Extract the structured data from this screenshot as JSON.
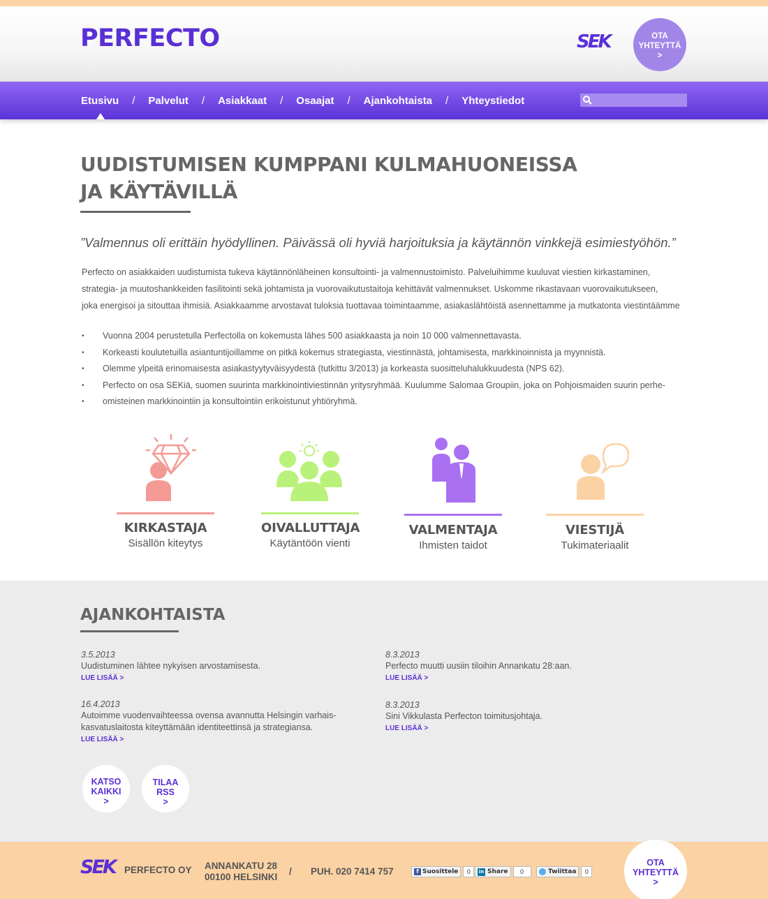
{
  "header": {
    "logo": "PERFECTO",
    "sek_logo": "SEK",
    "contact_button": {
      "line1": "OTA",
      "line2": "YHTEYTTÄ",
      "line3": ">"
    }
  },
  "nav": {
    "items": [
      "Etusivu",
      "Palvelut",
      "Asiakkaat",
      "Osaajat",
      "Ajankohtaista",
      "Yhteystiedot"
    ],
    "separator": "/",
    "active": "Etusivu",
    "search_value": ""
  },
  "main": {
    "title_line1": "UUDISTUMISEN KUMPPANI KULMAHUONEISSA",
    "title_line2": "JA KÄYTÄVILLÄ",
    "quote": "”Valmennus oli erittäin hyödyllinen. Päivässä oli hyviä harjoituksia ja käytännön vinkkejä esimiestyöhön.”",
    "intro_lines": [
      "Perfecto on asiakkaiden uudistumista tukeva käytännönläheinen konsultointi- ja valmennustoimisto. Palveluihimme kuuluvat viestien kirkastaminen,",
      "strategia- ja muutoshankkeiden fasilitointi sekä johtamista ja vuorovaikutustaitoja kehittävät valmennukset. Uskomme rikastavaan vuorovaikutukseen,",
      "joka energisoi ja sitouttaa ihmisiä. Asiakkaamme arvostavat tuloksia tuottavaa toimintaamme, asiakaslähtöistä asennettamme ja mutkatonta viestintäämme"
    ],
    "bullets": [
      "Vuonna 2004 perustetulla Perfectolla on kokemusta lähes 500 asiakkaasta ja noin 10 000 valmennettavasta.",
      "Korkeasti koulutetuilla asiantuntijoillamme on pitkä kokemus strategiasta, viestinnästä, johtamisesta, markkinoinnista ja myynnistä.",
      "Olemme ylpeitä erinomaisesta asiakastyytyväisyydestä (tutkittu 3/2013) ja korkeasta suositteluhalukkuudesta (NPS 62).",
      "Perfecto on osa SEKiä, suomen suurinta markkinointiviestinnän yritysryhmää. Kuulumme Salomaa Groupiin, joka on Pohjoismaiden suurin perhe-",
      "omisteinen markkinointiin ja konsultointiin erikoistunut yhtiöryhmä."
    ]
  },
  "roles": [
    {
      "title": "KIRKASTAJA",
      "subtitle": "Sisällön kiteytys",
      "icon": "diamond-person-icon",
      "color": "#f49a95"
    },
    {
      "title": "OIVALLUTTAJA",
      "subtitle": "Käytäntöön vienti",
      "icon": "lightbulb-group-icon",
      "color": "#b9f27a"
    },
    {
      "title": "VALMENTAJA",
      "subtitle": "Ihmisten taidot",
      "icon": "coach-people-icon",
      "color": "#a970f2"
    },
    {
      "title": "VIESTIJÄ",
      "subtitle": "Tukimateriaalit",
      "icon": "speech-person-icon",
      "color": "#fbd2a4"
    }
  ],
  "news": {
    "title": "AJANKOHTAISTA",
    "items": [
      {
        "date": "3.5.2013",
        "text_lines": [
          "Uudistuminen lähtee nykyisen arvostamisesta."
        ],
        "link": "LUE LISÄÄ >"
      },
      {
        "date": "16.4.2013",
        "text_lines": [
          "Autoimme vuodenvaihteessa ovensa avannutta Helsingin varhais-",
          "kasvatuslaitosta kiteyttämään identiteettinsä ja strategiansa."
        ],
        "link": "LUE LISÄÄ >"
      },
      {
        "date": "8.3.2013",
        "text_lines": [
          "Perfecto muutti uusiin tiloihin Annankatu 28:aan."
        ],
        "link": "LUE LISÄÄ >"
      },
      {
        "date": "8.3.2013",
        "text_lines": [
          "Sini Vikkulasta Perfecton toimitusjohtaja."
        ],
        "link": "LUE LISÄÄ >"
      }
    ],
    "view_all": {
      "line1": "KATSO",
      "line2": "KAIKKI",
      "line3": ">"
    },
    "rss": {
      "line1": "TILAA",
      "line2": "RSS",
      "line3": ">"
    }
  },
  "footer": {
    "sek_logo": "SEK",
    "company": "PERFECTO OY",
    "address_line1": "ANNANKATU 28",
    "address_line2": "00100 HELSINKI",
    "separator": "/",
    "phone": "PUH. 020 7414 757",
    "social": [
      {
        "label": "Suosittele",
        "count": "0",
        "icon": "facebook-icon"
      },
      {
        "label": "Share",
        "count": "0",
        "icon": "linkedin-icon"
      },
      {
        "label": "Twiittaa",
        "count": "0",
        "icon": "twitter-icon"
      }
    ],
    "contact_button": {
      "line1": "OTA",
      "line2": "YHTEYTTÄ",
      "line3": ">"
    }
  },
  "colors": {
    "brand": "#5a2fd6",
    "nav_gradient_top": "#8f66f2",
    "nav_gradient_bottom": "#5c33d8",
    "accent_peach": "#fbd2a4",
    "news_background": "#ececec"
  }
}
